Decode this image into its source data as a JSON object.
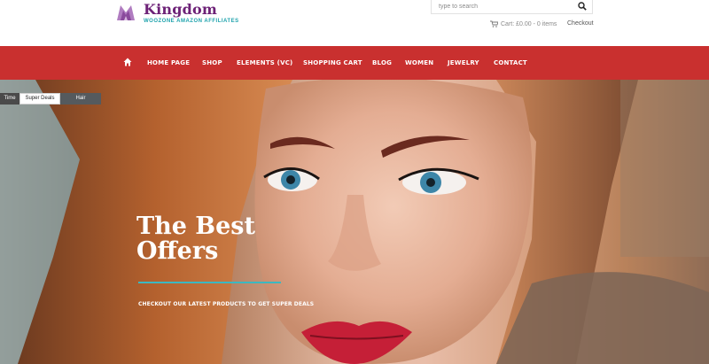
{
  "brand": {
    "name": "Kingdom",
    "tagline": "WOOZONE AMAZON AFFILIATES",
    "colors": {
      "name": "#6d2277",
      "tagline": "#1fa3ad"
    }
  },
  "search": {
    "placeholder": "type to search",
    "icon": "search-icon"
  },
  "cart": {
    "label": "Cart: £0.00 - 0 items",
    "icon": "cart-icon"
  },
  "checkout": {
    "label": "Checkout"
  },
  "nav": {
    "color": "#c9302f",
    "home_icon": "home-icon",
    "items": [
      {
        "label": "HOME PAGE"
      },
      {
        "label": "SHOP"
      },
      {
        "label": "ELEMENTS (VC)"
      },
      {
        "label": "SHOPPING CART"
      },
      {
        "label": "BLOG"
      },
      {
        "label": "WOMEN"
      },
      {
        "label": "JEWELRY"
      },
      {
        "label": "CONTACT"
      }
    ]
  },
  "hero": {
    "tabs": [
      {
        "label": "Time"
      },
      {
        "label": "Super Deals",
        "active": true
      },
      {
        "label": "Hair"
      }
    ],
    "title_line1": "The Best",
    "title_line2": "Offers",
    "subtitle": "CHECKOUT OUR LATEST PRODUCTS TO GET SUPER DEALS",
    "accent": "#3cb8c0"
  }
}
